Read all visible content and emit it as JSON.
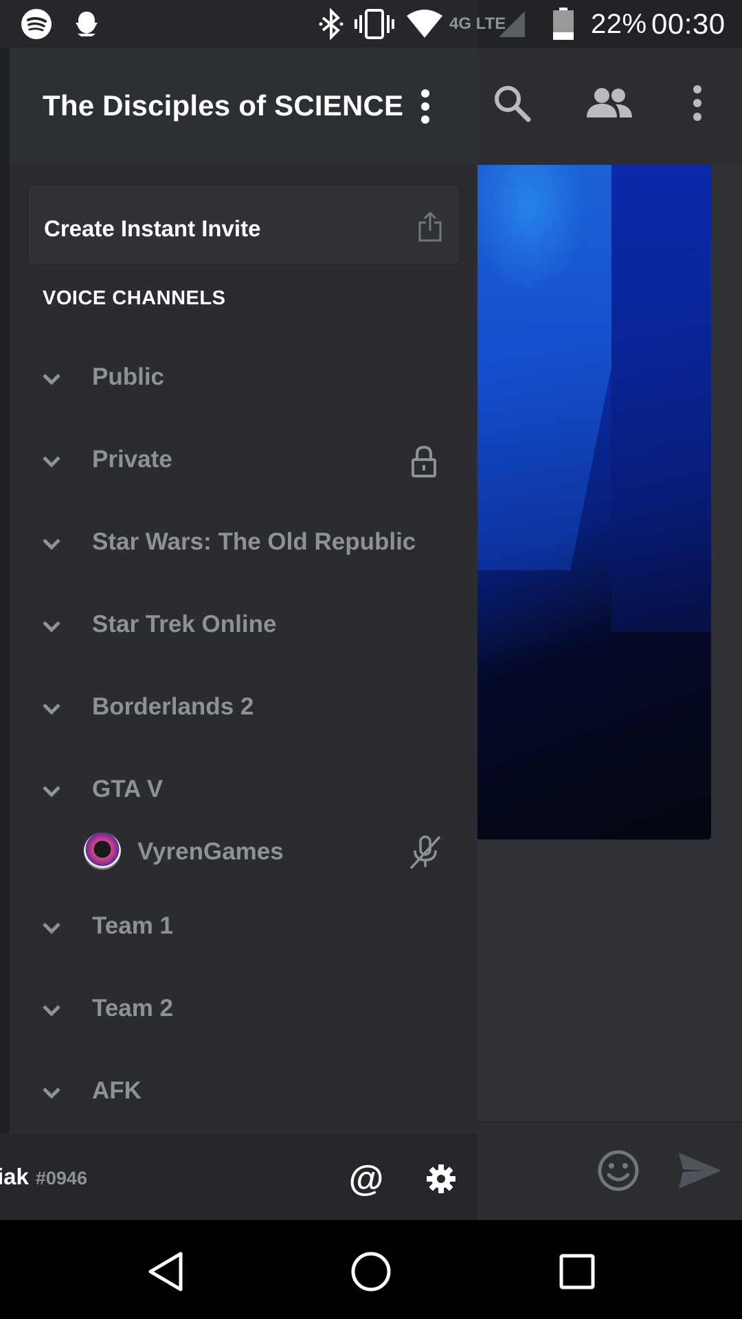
{
  "status_bar": {
    "battery_percent": "22%",
    "time": "00:30",
    "network_label": "4G LTE",
    "icons": [
      "spotify-icon",
      "snapchat-icon",
      "bluetooth-icon",
      "vibrate-icon",
      "wifi-icon",
      "signal-icon",
      "battery-icon"
    ]
  },
  "drawer": {
    "server_name": "The Disciples of SCIENCE",
    "invite_label": "Create Instant Invite",
    "section_label": "VOICE CHANNELS",
    "channels": [
      {
        "name": "Public",
        "locked": false
      },
      {
        "name": "Private",
        "locked": true
      },
      {
        "name": "Star Wars: The Old Republic",
        "locked": false
      },
      {
        "name": "Star Trek Online",
        "locked": false
      },
      {
        "name": "Borderlands 2",
        "locked": false
      },
      {
        "name": "GTA V",
        "locked": false,
        "members": [
          {
            "name": "VyrenGames",
            "muted": true
          }
        ]
      },
      {
        "name": "Team 1",
        "locked": false
      },
      {
        "name": "Team 2",
        "locked": false
      },
      {
        "name": "AFK",
        "locked": false
      }
    ]
  },
  "user_panel": {
    "username": "iak",
    "discriminator": "#0946",
    "mention_symbol": "@"
  },
  "colors": {
    "drawer_bg": "#2a2c31",
    "header_bg": "#2c2f33",
    "muted_text": "#8e9297",
    "accent": "#ffffff"
  }
}
